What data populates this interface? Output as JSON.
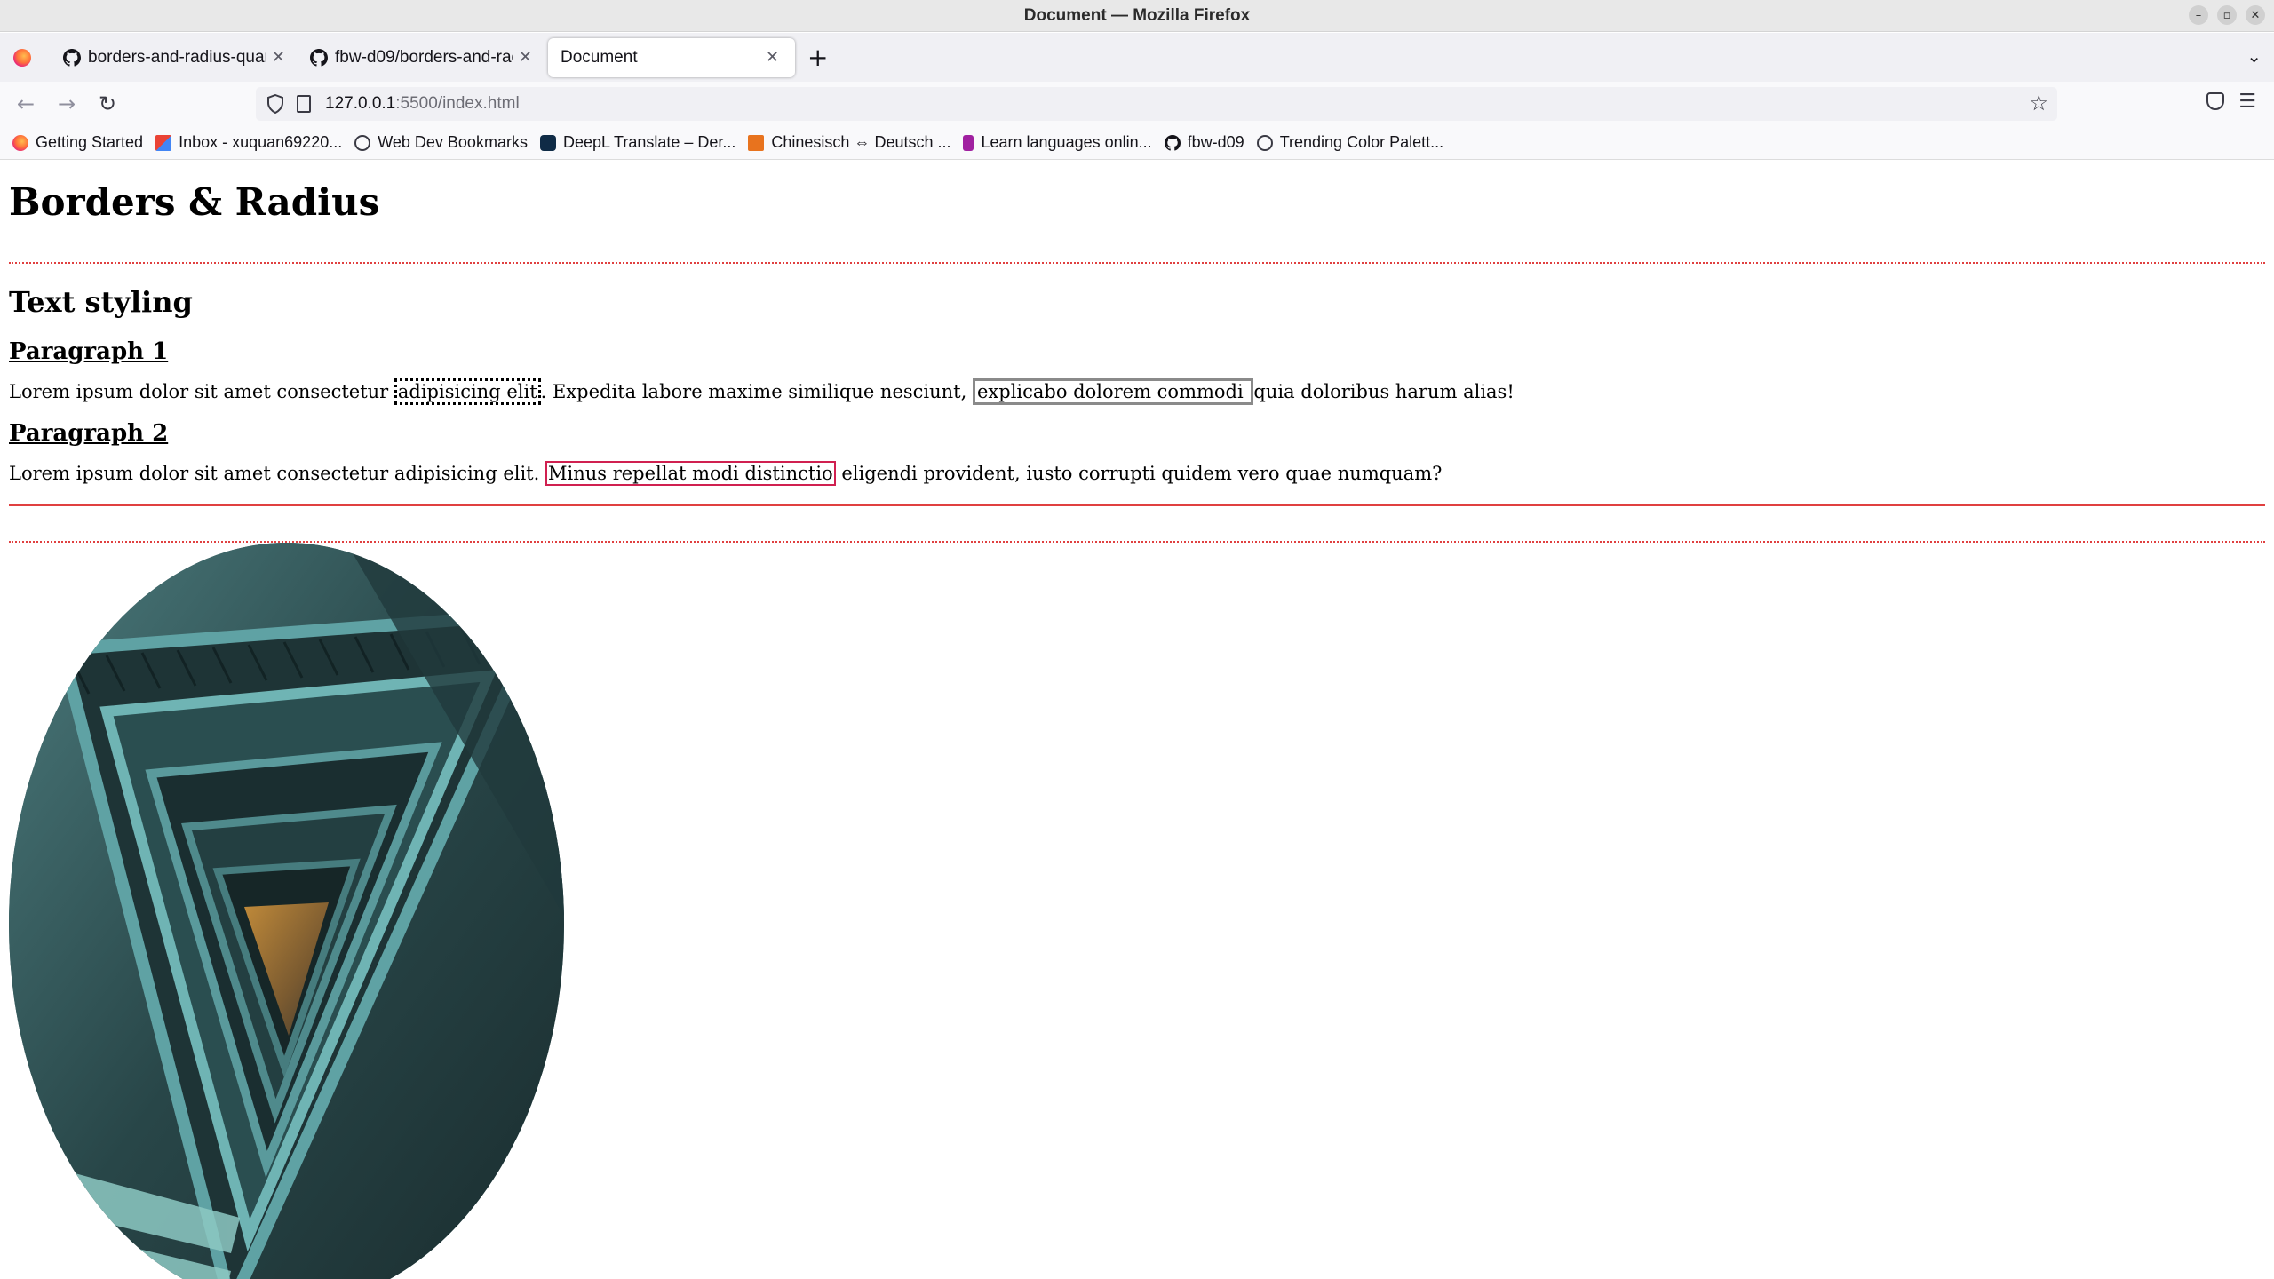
{
  "window": {
    "title": "Document — Mozilla Firefox"
  },
  "tabs": [
    {
      "label": "borders-and-radius-quan",
      "icon": "github-icon"
    },
    {
      "label": "fbw-d09/borders-and-rad",
      "icon": "github-icon"
    },
    {
      "label": "Document",
      "active": true
    }
  ],
  "navbar": {
    "url_host": "127.0.0.1",
    "url_path": ":5500/index.html"
  },
  "bookmarks": [
    {
      "label": "Getting Started",
      "icon": "firefox-icon"
    },
    {
      "label": "Inbox - xuquan69220...",
      "icon": "gmail-icon"
    },
    {
      "label": "Web Dev Bookmarks",
      "icon": "globe-icon"
    },
    {
      "label": "DeepL Translate – Der...",
      "icon": "deepl-icon"
    },
    {
      "label": "Chinesisch ⇔ Deutsch ...",
      "icon": "dict-icon"
    },
    {
      "label": "Learn languages onlin...",
      "icon": "lang-icon"
    },
    {
      "label": "fbw-d09",
      "icon": "github-icon"
    },
    {
      "label": "Trending Color Palett...",
      "icon": "globe-icon"
    }
  ],
  "page": {
    "heading": "Borders & Radius",
    "section_title": "Text styling",
    "p1_title": "Paragraph 1",
    "p1_a": "Lorem ipsum dolor sit amet consectetur ",
    "p1_hl1": "adipisicing elit",
    "p1_b": ". Expedita labore maxime similique nesciunt, ",
    "p1_hl2": "explicabo dolorem commodi ",
    "p1_c": " quia doloribus harum alias!",
    "p2_title": "Paragraph 2",
    "p2_a": "Lorem ipsum dolor sit amet consectetur adipisicing elit. ",
    "p2_hl": "Minus repellat modi distinctio",
    "p2_b": " eligendi provident, iusto corrupti quidem vero quae numquam?"
  },
  "colors": {
    "rule": "#e04040",
    "highlight_red": "#d02050"
  }
}
